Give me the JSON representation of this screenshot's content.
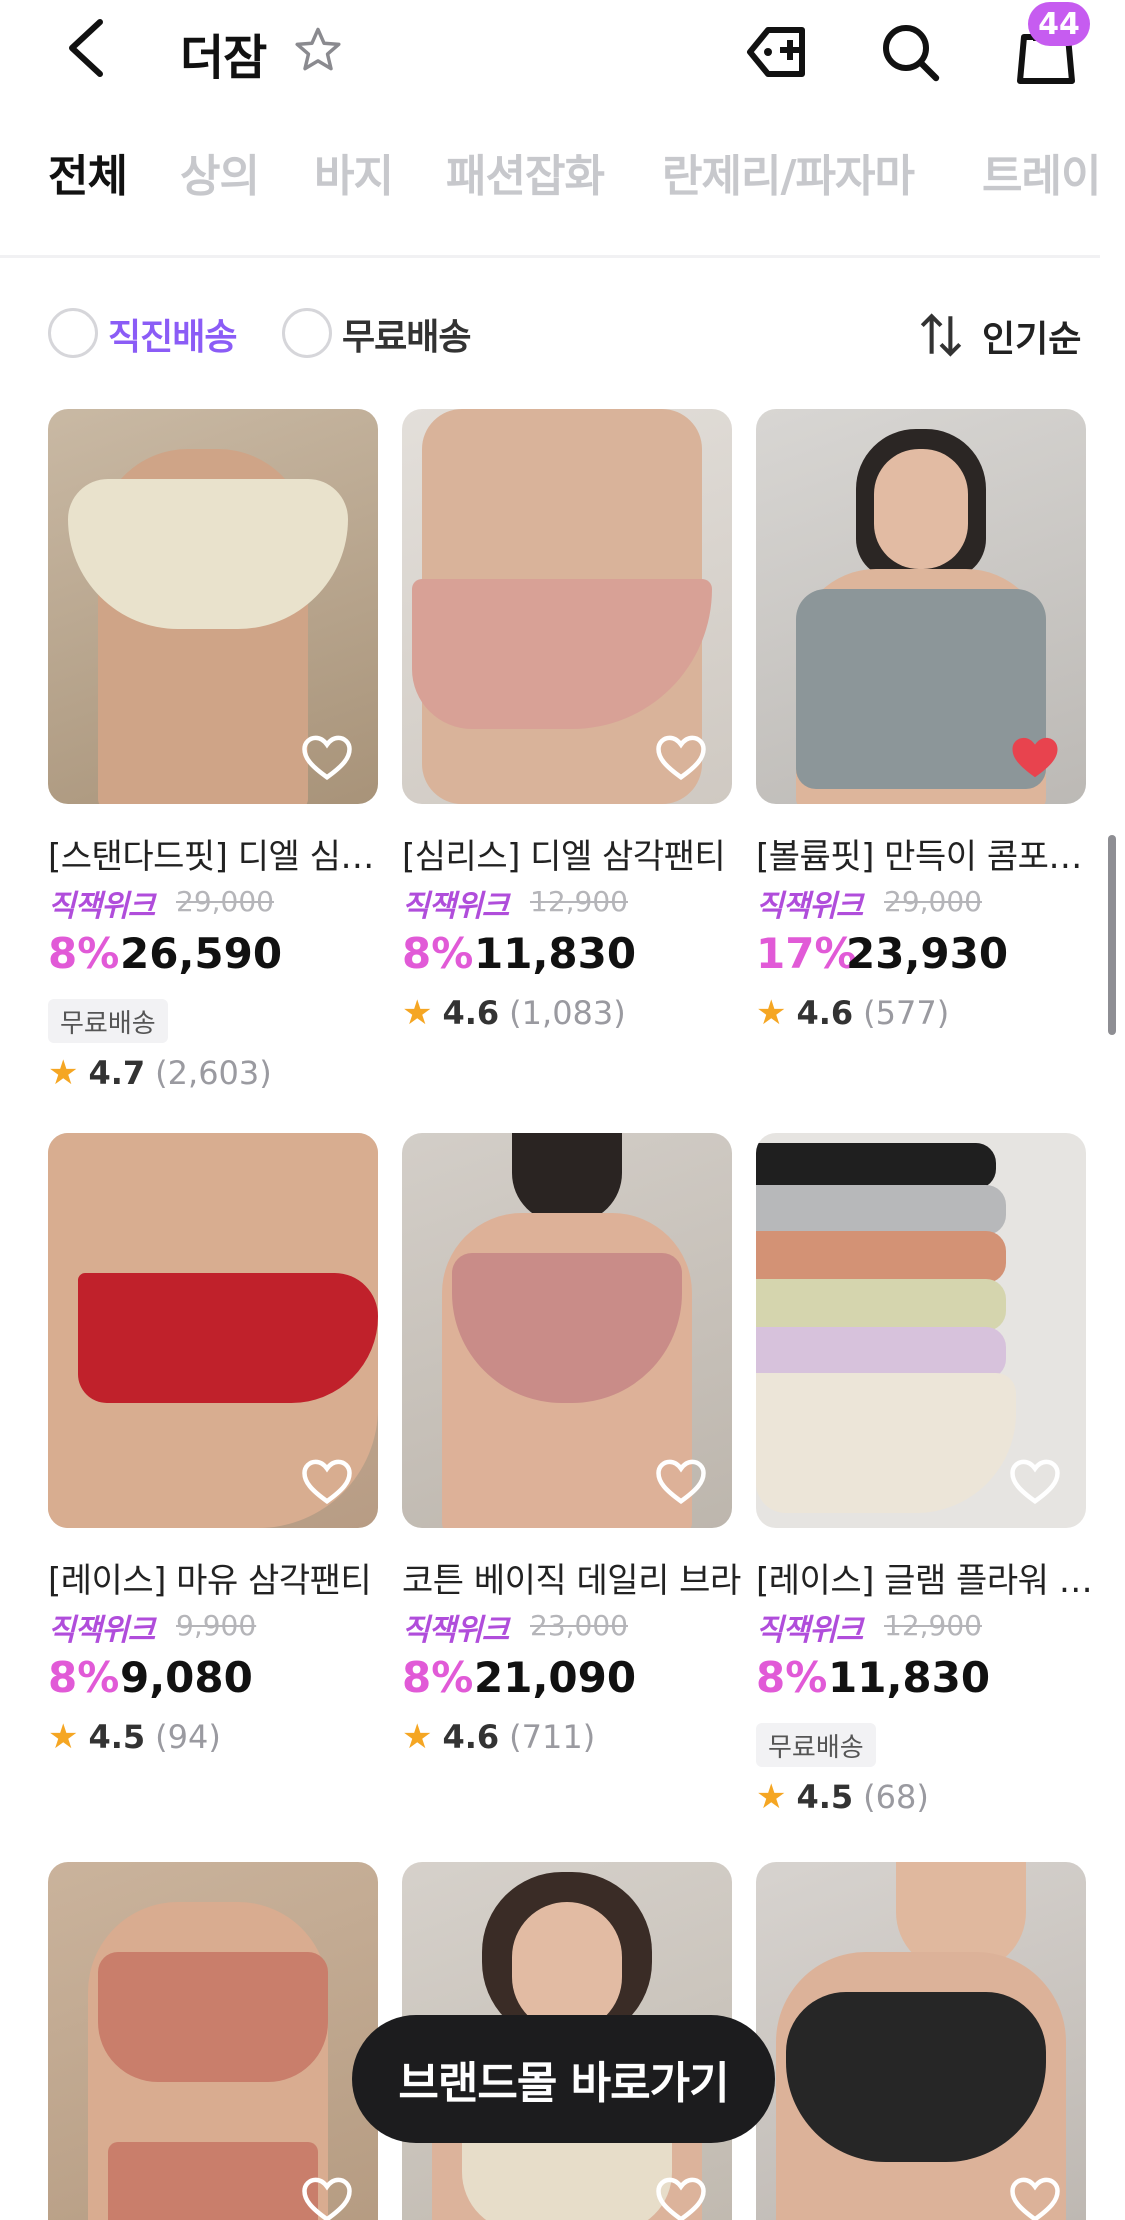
{
  "header": {
    "title": "더잠",
    "cart_count": "44",
    "icons": [
      "back-arrow-icon",
      "star-outline-icon",
      "coupon-tag-icon",
      "search-icon",
      "shopping-bag-icon"
    ]
  },
  "tabs": [
    {
      "label": "전체",
      "active": true
    },
    {
      "label": "상의"
    },
    {
      "label": "바지"
    },
    {
      "label": "패션잡화"
    },
    {
      "label": "란제리/파자마"
    },
    {
      "label": "트레이닝"
    }
  ],
  "filters": {
    "direct_shipping": "직진배송",
    "free_shipping": "무료배송",
    "sort": "인기순"
  },
  "products": [
    {
      "name": "[스탠다드핏] 디엘 심리스 브라",
      "promo": "직잭위크",
      "original_price": "29,000",
      "discount": "8%",
      "price": "26,590",
      "free_shipping": "무료배송",
      "rating": "4.7",
      "reviews": "(2,603)",
      "liked": false
    },
    {
      "name": "[심리스] 디엘 삼각팬티",
      "promo": "직잭위크",
      "original_price": "12,900",
      "discount": "8%",
      "price": "11,830",
      "rating": "4.6",
      "reviews": "(1,083)",
      "liked": false
    },
    {
      "name": "[볼륨핏] 만득이 콤포트 브라",
      "promo": "직잭위크",
      "original_price": "29,000",
      "discount": "17%",
      "price": "23,930",
      "rating": "4.6",
      "reviews": "(577)",
      "liked": true
    },
    {
      "name": "[레이스] 마유 삼각팬티",
      "promo": "직잭위크",
      "original_price": "9,900",
      "discount": "8%",
      "price": "9,080",
      "rating": "4.5",
      "reviews": "(94)",
      "liked": false
    },
    {
      "name": "코튼 베이직 데일리 브라",
      "promo": "직잭위크",
      "original_price": "23,000",
      "discount": "8%",
      "price": "21,090",
      "rating": "4.6",
      "reviews": "(711)",
      "liked": false
    },
    {
      "name": "[레이스] 글램 플라워 팬티",
      "promo": "직잭위크",
      "original_price": "12,900",
      "discount": "8%",
      "price": "11,830",
      "free_shipping": "무료배송",
      "rating": "4.5",
      "reviews": "(68)",
      "liked": false
    }
  ],
  "cta": {
    "label": "브랜드몰 바로가기"
  },
  "colors": {
    "accent": "#b04ddb",
    "discount": "#e15ad7",
    "badge": "#c65cf0",
    "heart_liked": "#e8434e",
    "star": "#f5a623"
  }
}
